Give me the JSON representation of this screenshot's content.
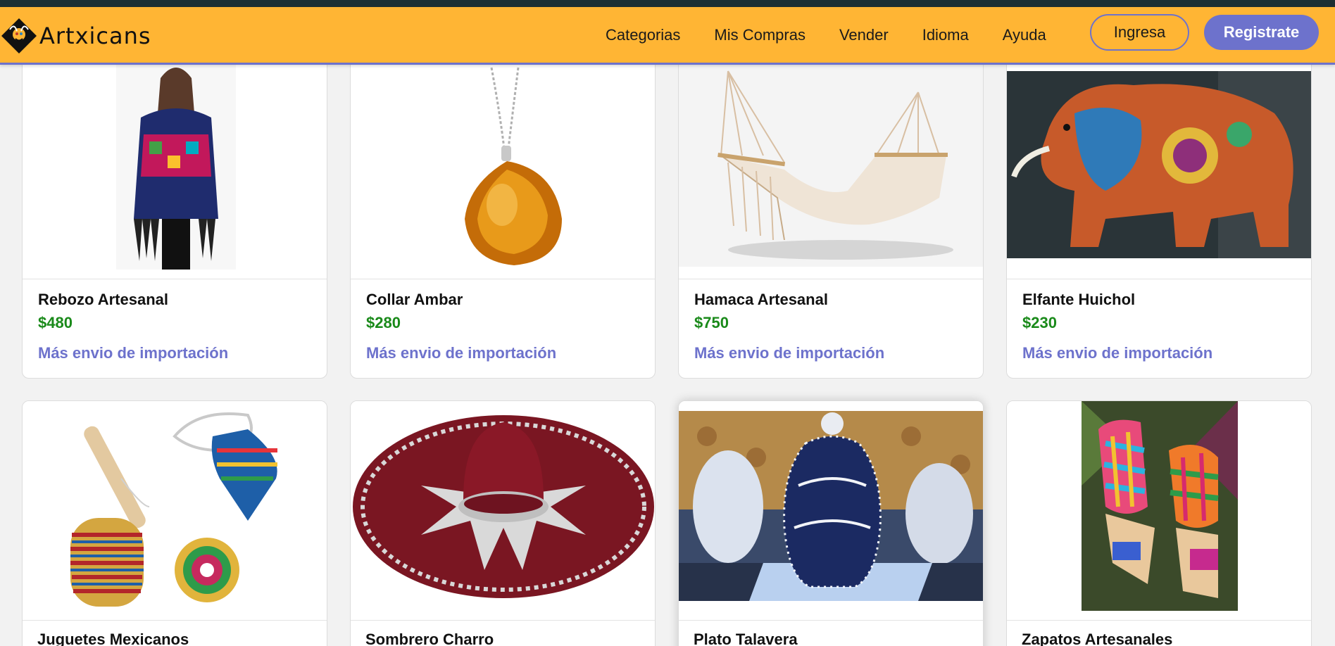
{
  "brand": {
    "name": "Artxicans"
  },
  "nav": {
    "links": [
      "Categorias",
      "Mis Compras",
      "Vender",
      "Idioma",
      "Ayuda"
    ],
    "login_label": "Ingresa",
    "register_label": "Registrate"
  },
  "products": [
    {
      "title": "Rebozo Artesanal",
      "price": "$480",
      "shipping": "Más envio de importación",
      "image": "rebozo-photo"
    },
    {
      "title": "Collar Ambar",
      "price": "$280",
      "shipping": "Más envio de importación",
      "image": "amber-necklace-photo"
    },
    {
      "title": "Hamaca Artesanal",
      "price": "$750",
      "shipping": "Más envio de importación",
      "image": "hammock-photo"
    },
    {
      "title": "Elfante Huichol",
      "price": "$230",
      "shipping": "Más envio de importación",
      "image": "huichol-elephant-photo"
    },
    {
      "title": "Juguetes Mexicanos",
      "image": "mexican-toys-photo"
    },
    {
      "title": "Sombrero Charro",
      "image": "charro-hat-photo"
    },
    {
      "title": "Plato Talavera",
      "image": "talavera-vase-photo"
    },
    {
      "title": "Zapatos Artesanales",
      "image": "artisan-shoes-photo"
    }
  ],
  "colors": {
    "header_bg": "#ffb534",
    "accent": "#6d72cc",
    "price": "#1a8a1a",
    "page_bg": "#f2f2f2"
  }
}
